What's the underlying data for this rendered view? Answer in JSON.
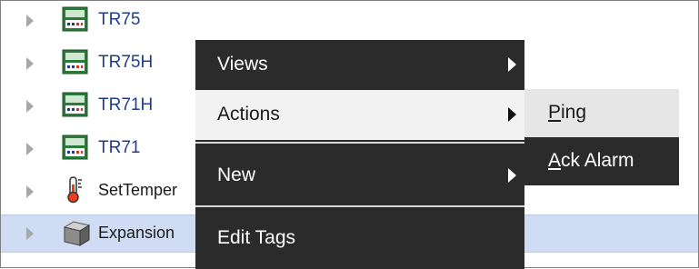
{
  "tree": {
    "rows": [
      {
        "label": "TR75",
        "icon": "controller-icon"
      },
      {
        "label": "TR75H",
        "icon": "controller-icon"
      },
      {
        "label": "TR71H",
        "icon": "controller-icon"
      },
      {
        "label": "TR71",
        "icon": "controller-icon"
      },
      {
        "label": "SetTemper",
        "icon": "thermometer-icon"
      },
      {
        "label": "Expansion",
        "icon": "box-icon",
        "selected": true
      }
    ]
  },
  "context_menu": {
    "items": [
      {
        "label": "Views",
        "has_submenu": true
      },
      {
        "label": "Actions",
        "has_submenu": true,
        "active": true
      },
      {
        "label": "New",
        "has_submenu": true
      },
      {
        "label": "Edit Tags",
        "has_submenu": false
      }
    ]
  },
  "submenu": {
    "items": [
      {
        "mnemonic": "P",
        "rest": "ing",
        "hover": true
      },
      {
        "mnemonic": "A",
        "rest": "ck Alarm"
      }
    ]
  },
  "colors": {
    "menu_bg": "#2b2b2b",
    "menu_active_bg": "#f2f2f2",
    "selection_bg": "#cfdcf3",
    "link_text": "#1f3d8a"
  }
}
